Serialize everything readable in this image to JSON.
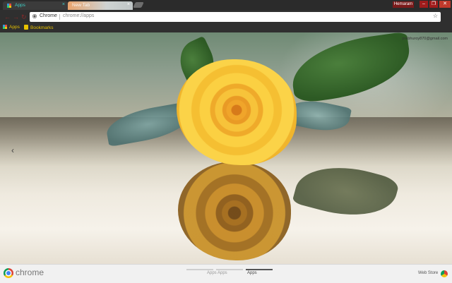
{
  "tabs": [
    {
      "title": "Apps",
      "close": "×"
    },
    {
      "title": "New Tab",
      "close": "×"
    }
  ],
  "window": {
    "user": "Hemaram",
    "minimize": "–",
    "maximize": "❐",
    "close": "✕"
  },
  "toolbar": {
    "back": "←",
    "forward": "→",
    "reload": "↻",
    "chip": "Chrome",
    "url": "chrome://apps",
    "star": "☆"
  },
  "bookmarks": [
    {
      "label": "Apps"
    },
    {
      "label": "Bookmarks"
    }
  ],
  "content": {
    "email": "prabhuroy870@gmail.com",
    "prev_arrow": "‹"
  },
  "bottom": {
    "logo_text": "chrome",
    "pages": [
      {
        "label": "Apps"
      },
      {
        "label": "Apps"
      },
      {
        "label": "Apps",
        "active": true
      }
    ],
    "webstore": "Web Store"
  }
}
